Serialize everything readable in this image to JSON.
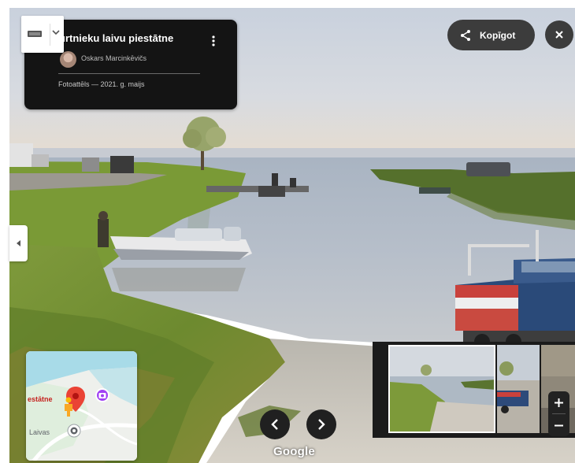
{
  "info_card": {
    "title": "urtnieku laivu piestātne",
    "author": "Oskars Marcinkēvičs",
    "photo_date": "Fotoattēls — 2021. g. maijs",
    "more_icon": "more-vert-icon"
  },
  "side_toggle": {
    "panel_icon": "panel-icon",
    "caret_icon": "caret-down-icon"
  },
  "share": {
    "label": "Kopīgot",
    "icon": "share-icon"
  },
  "close": {
    "icon": "close-icon"
  },
  "minimap": {
    "place_label": "estātne",
    "area_label": "Laivas",
    "pin_icon": "map-pin-icon",
    "camera_icon": "photo-camera-icon",
    "pegman_icon": "pegman-icon",
    "target_icon": "location-target-icon"
  },
  "navigation": {
    "prev_icon": "chevron-left-icon",
    "next_icon": "chevron-right-icon"
  },
  "attribution": "Google",
  "zoom": {
    "in_icon": "plus-icon",
    "out_icon": "minus-icon"
  },
  "colors": {
    "card_bg": "#141414",
    "button_bg": "#3c3c3c",
    "pin_red": "#ea4335",
    "camera_purple": "#a142f4"
  }
}
